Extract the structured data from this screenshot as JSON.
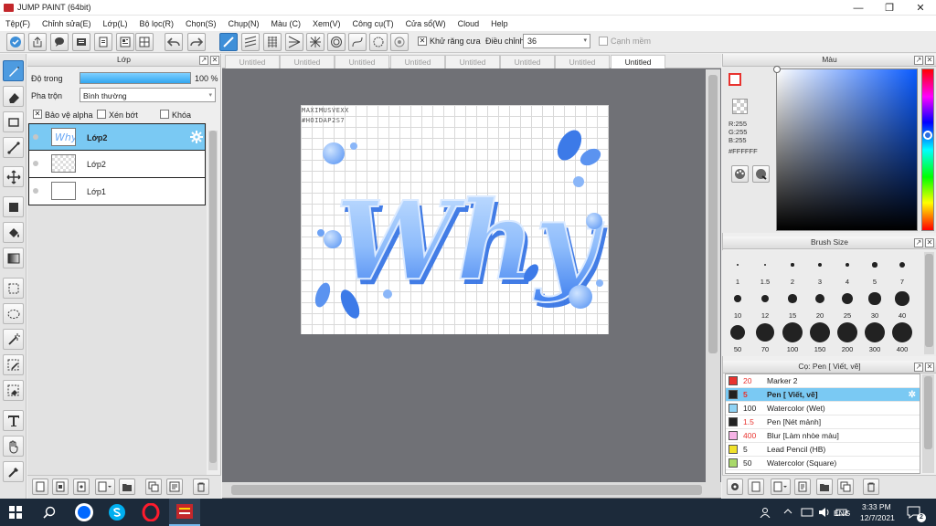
{
  "window": {
    "title": "JUMP PAINT (64bit)"
  },
  "menu": [
    "Tệp(F)",
    "Chỉnh sửa(E)",
    "Lớp(L)",
    "Bộ lọc(R)",
    "Chọn(S)",
    "Chụp(N)",
    "Màu (C)",
    "Xem(V)",
    "Công cụ(T)",
    "Cửa sổ(W)",
    "Cloud",
    "Help"
  ],
  "toolbar": {
    "antialias_label": "Khử răng cưa",
    "antialias_checked": "✕",
    "adjust_label": "Điều chỉnh",
    "adjust_value": "36",
    "snap_label": "Cạnh mềm"
  },
  "layer_panel": {
    "title": "Lớp",
    "opacity_label": "Độ trong",
    "opacity_value": "100 %",
    "opacity_fraction": 1.0,
    "blend_label": "Pha trộn",
    "blend_value": "Bình thường",
    "protect_alpha": "Bảo vệ alpha",
    "clipping": "Xén bớt",
    "lock": "Khóa",
    "layers": [
      {
        "name": "Lớp2",
        "selected": true
      },
      {
        "name": "Lớp2",
        "selected": false
      },
      {
        "name": "Lớp1",
        "selected": false
      }
    ]
  },
  "tabs": [
    "Untitled",
    "Untitled",
    "Untitled",
    "Untitled",
    "Untitled",
    "Untitled",
    "Untitled",
    "Untitled"
  ],
  "active_tab_index": 7,
  "canvas": {
    "signature_line1": "MAXIMUSVEXX",
    "signature_line2": "#HOIDAP2S7",
    "artwork_text": "Why"
  },
  "color_panel": {
    "title": "Màu",
    "r": "R:255",
    "g": "G:255",
    "b": "B:255",
    "hex": "#FFFFFF",
    "primary_color": "#ffffff",
    "accent": "#0a5bff"
  },
  "brush_size_panel": {
    "title": "Brush Size",
    "sizes": [
      "1",
      "1.5",
      "2",
      "3",
      "4",
      "5",
      "7",
      "10",
      "12",
      "15",
      "20",
      "25",
      "30",
      "40",
      "50",
      "70",
      "100",
      "150",
      "200",
      "300",
      "400"
    ]
  },
  "tool_panel": {
    "title": "Cọ: Pen [ Viết, vẽ]",
    "items": [
      {
        "size": "20",
        "name": "Marker 2",
        "color": "#e8332f",
        "size_color": "#e8332f"
      },
      {
        "size": "5",
        "name": "Pen [ Viết, vẽ]",
        "color": "#222222",
        "size_color": "#e8332f",
        "selected": true
      },
      {
        "size": "100",
        "name": "Watercolor (Wet)",
        "color": "#8fd3f5",
        "size_color": "#222222"
      },
      {
        "size": "1.5",
        "name": "Pen [Nét mảnh]",
        "color": "#222222",
        "size_color": "#e8332f"
      },
      {
        "size": "400",
        "name": "Blur [Làm nhòe màu]",
        "color": "#f6b3e6",
        "size_color": "#e8332f"
      },
      {
        "size": "5",
        "name": "Lead Pencil (HB)",
        "color": "#f0e12a",
        "size_color": "#222222"
      },
      {
        "size": "50",
        "name": "Watercolor (Square)",
        "color": "#a9d96a",
        "size_color": "#222222"
      }
    ]
  },
  "taskbar": {
    "language": "ENG",
    "time": "3:33 PM",
    "date": "12/7/2021",
    "notifications": "2"
  }
}
